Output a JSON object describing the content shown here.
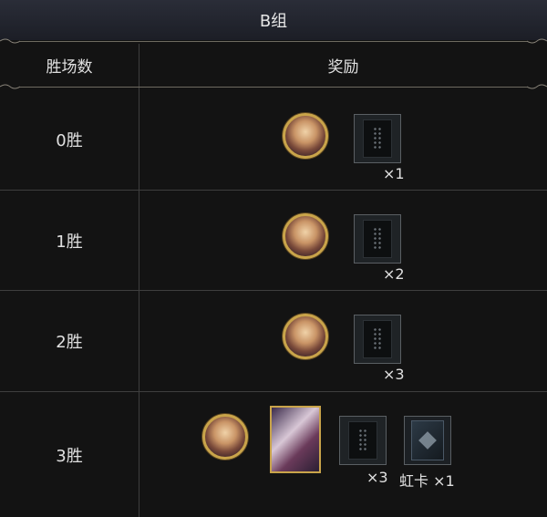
{
  "title": "B组",
  "headers": {
    "wins": "胜场数",
    "rewards": "奖励"
  },
  "rows": [
    {
      "wins": "0胜",
      "deck_count": "×1"
    },
    {
      "wins": "1胜",
      "deck_count": "×2"
    },
    {
      "wins": "2胜",
      "deck_count": "×3"
    },
    {
      "wins": "3胜",
      "deck_count": "×3",
      "rainbow_label": "虹卡 ×1"
    }
  ],
  "icons": {
    "avatar": "character-avatar-icon",
    "deck": "card-pack-icon",
    "card": "character-card-icon",
    "rainbow": "rainbow-card-icon"
  },
  "colors": {
    "title_bar": "#23262f",
    "background": "#131313",
    "gold_border": "#c9a44a",
    "grid_line": "#3e3e3e"
  }
}
